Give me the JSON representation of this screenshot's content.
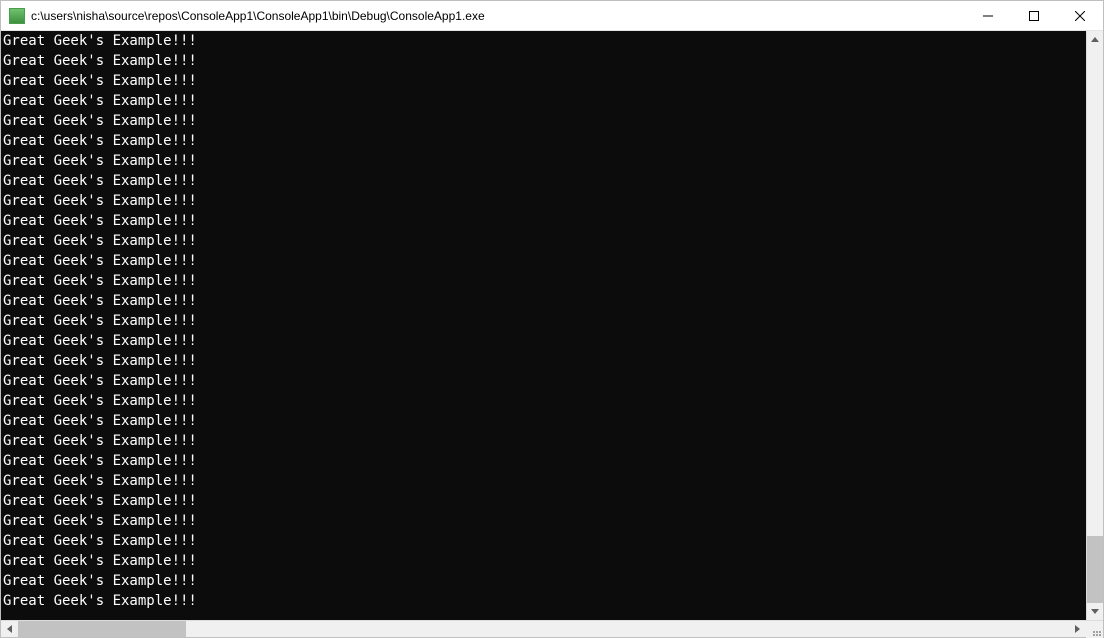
{
  "window": {
    "title": "c:\\users\\nisha\\source\\repos\\ConsoleApp1\\ConsoleApp1\\bin\\Debug\\ConsoleApp1.exe"
  },
  "console": {
    "line_text": "Great Geek's Example!!!",
    "visible_line_count": 29
  },
  "vscroll": {
    "thumb_top_pct": 88,
    "thumb_height_pct": 12
  },
  "hscroll": {
    "thumb_left_pct": 0,
    "thumb_width_pct": 16
  }
}
